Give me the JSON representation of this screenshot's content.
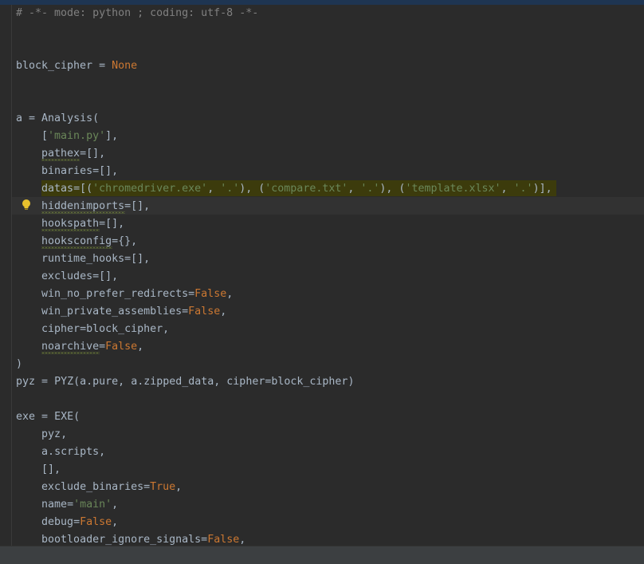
{
  "editor": {
    "language": "python",
    "lines": [
      "# -*- mode: python ; coding: utf-8 -*-",
      "",
      "",
      "block_cipher = None",
      "",
      "",
      "a = Analysis(",
      "    ['main.py'],",
      "    pathex=[],",
      "    binaries=[],",
      "    datas=[('chromedriver.exe', '.'), ('compare.txt', '.'), ('template.xlsx', '.')],",
      "    hiddenimports=[],",
      "    hookspath=[],",
      "    hooksconfig={},",
      "    runtime_hooks=[],",
      "    excludes=[],",
      "    win_no_prefer_redirects=False,",
      "    win_private_assemblies=False,",
      "    cipher=block_cipher,",
      "    noarchive=False,",
      ")",
      "pyz = PYZ(a.pure, a.zipped_data, cipher=block_cipher)",
      "",
      "exe = EXE(",
      "    pyz,",
      "    a.scripts,",
      "    [],",
      "    exclude_binaries=True,",
      "    name='main',",
      "    debug=False,",
      "    bootloader_ignore_signals=False,"
    ],
    "highlighted_line": 11,
    "caret_line": 12,
    "gutter_icons": [
      {
        "line": 12,
        "icon": "lightbulb-icon",
        "color": "#e8c12d"
      }
    ],
    "squiggle_words": [
      "pathex",
      "hiddenimports",
      "hookspath",
      "hooksconfig",
      "noarchive"
    ]
  },
  "colors": {
    "background": "#2b2b2b",
    "comment": "#808080",
    "keyword": "#cc7832",
    "string": "#6a8759",
    "default": "#a9b7c6",
    "highlight": "#3c3b0c"
  }
}
